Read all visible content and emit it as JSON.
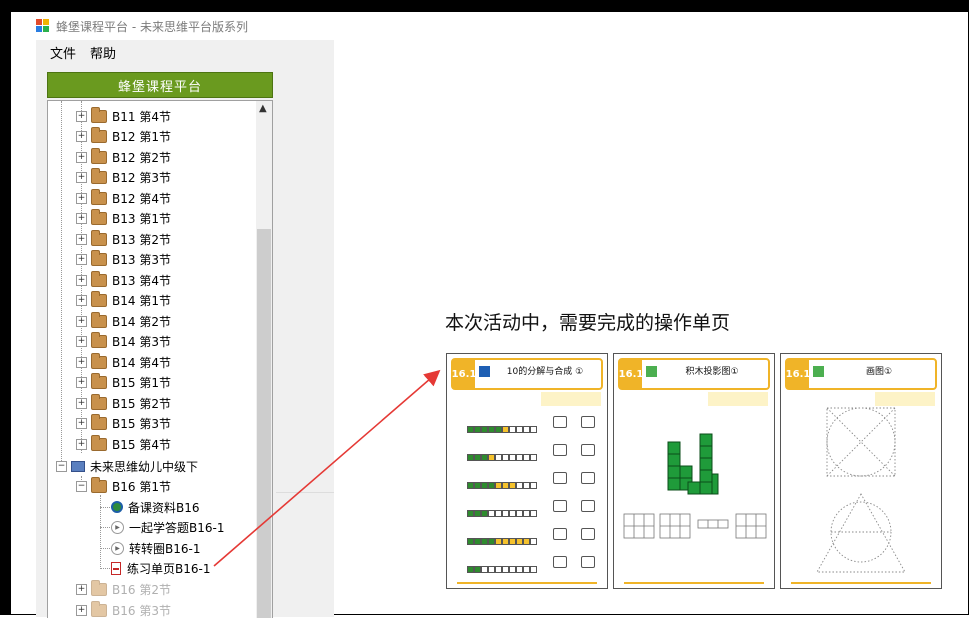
{
  "window": {
    "title": "蜂堡课程平台 - 未来思维平台版系列"
  },
  "menu": {
    "file": "文件",
    "help": "帮助"
  },
  "panel": {
    "button_label": "蜂堡课程平台"
  },
  "tree": {
    "rows": [
      "B11 第4节",
      "B12 第1节",
      "B12 第2节",
      "B12 第3节",
      "B12 第4节",
      "B13 第1节",
      "B13 第2节",
      "B13 第3节",
      "B13 第4节",
      "B14 第1节",
      "B14 第2节",
      "B14 第3节",
      "B14 第4节",
      "B15 第1节",
      "B15 第2节",
      "B15 第3节",
      "B15 第4节"
    ],
    "root": "未来思维幼儿中级下",
    "b16_1": "B16 第1节",
    "children": [
      "备课资料B16",
      "一起学答题B16-1",
      "转转圈B16-1",
      "练习单页B16-1"
    ],
    "b16_2": "B16 第2节",
    "b16_3": "B16 第3节"
  },
  "content": {
    "heading": "本次活动中，需要完成的操作单页",
    "pages": [
      {
        "num": "16.1",
        "title": "10的分解与合成 ①"
      },
      {
        "num": "16.1",
        "title": "积木投影图①"
      },
      {
        "num": "16.1",
        "title": "画图①"
      }
    ]
  },
  "colors": {
    "accent_green": "#6a9a1f",
    "page_orange": "#f0b428",
    "arrow_red": "#e53935"
  }
}
